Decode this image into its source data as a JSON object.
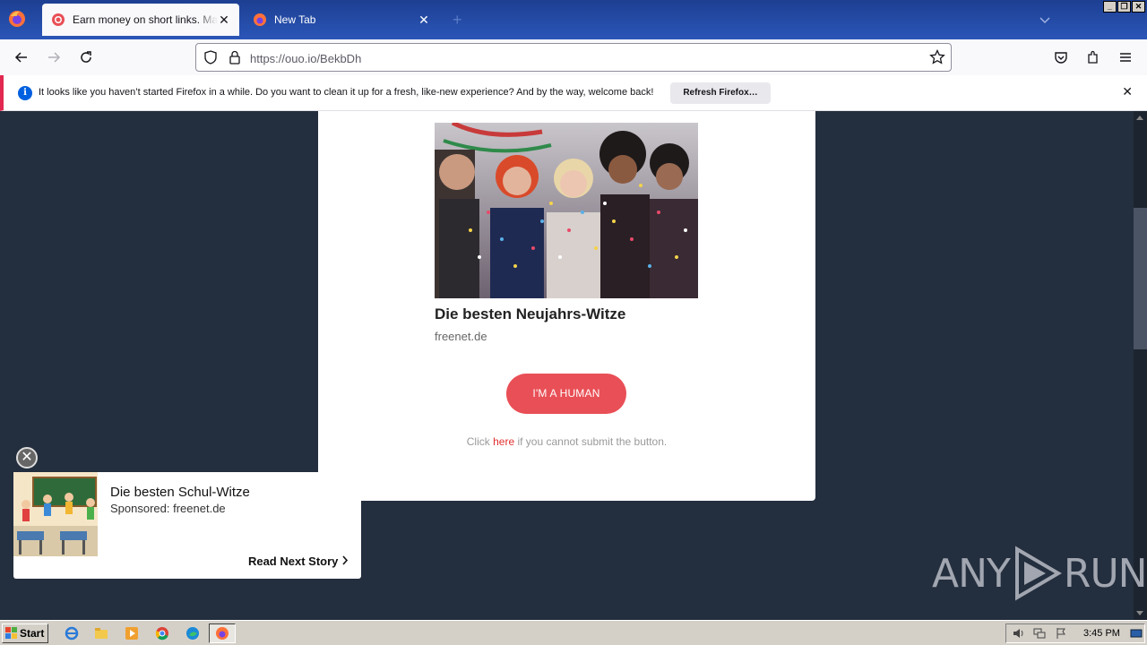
{
  "browser": {
    "tabs": [
      {
        "label": "Earn money on short links. Make sh",
        "active": true
      },
      {
        "label": "New Tab",
        "active": false
      }
    ],
    "new_tab_symbol": "+",
    "window_buttons": {
      "minimize": "_",
      "restore": "❐",
      "close": "✕"
    },
    "url": "https://ouo.io/BekbDh",
    "notification": {
      "message": "It looks like you haven’t started Firefox in a while. Do you want to clean it up for a fresh, like-new experience? And by the way, welcome back!",
      "button": "Refresh Firefox…",
      "close": "✕"
    }
  },
  "page": {
    "ad": {
      "title": "Die besten Neujahrs-Witze",
      "source": "freenet.de"
    },
    "human_button": "I'M A HUMAN",
    "click_text": {
      "before": "Click ",
      "link": "here",
      "after": " if you cannot submit the button."
    }
  },
  "popup": {
    "close": "✕",
    "title": "Die besten Schul-Witze",
    "sponsor": "Sponsored: freenet.de",
    "next": "Read Next Story"
  },
  "watermark": {
    "left": "ANY",
    "right": "RUN"
  },
  "taskbar": {
    "start": "Start",
    "clock": "3:45 PM"
  },
  "colors": {
    "accent_button": "#e94f56",
    "link": "#e0312f",
    "page_background": "#232e3e",
    "tabstrip": "#2b56b8"
  }
}
